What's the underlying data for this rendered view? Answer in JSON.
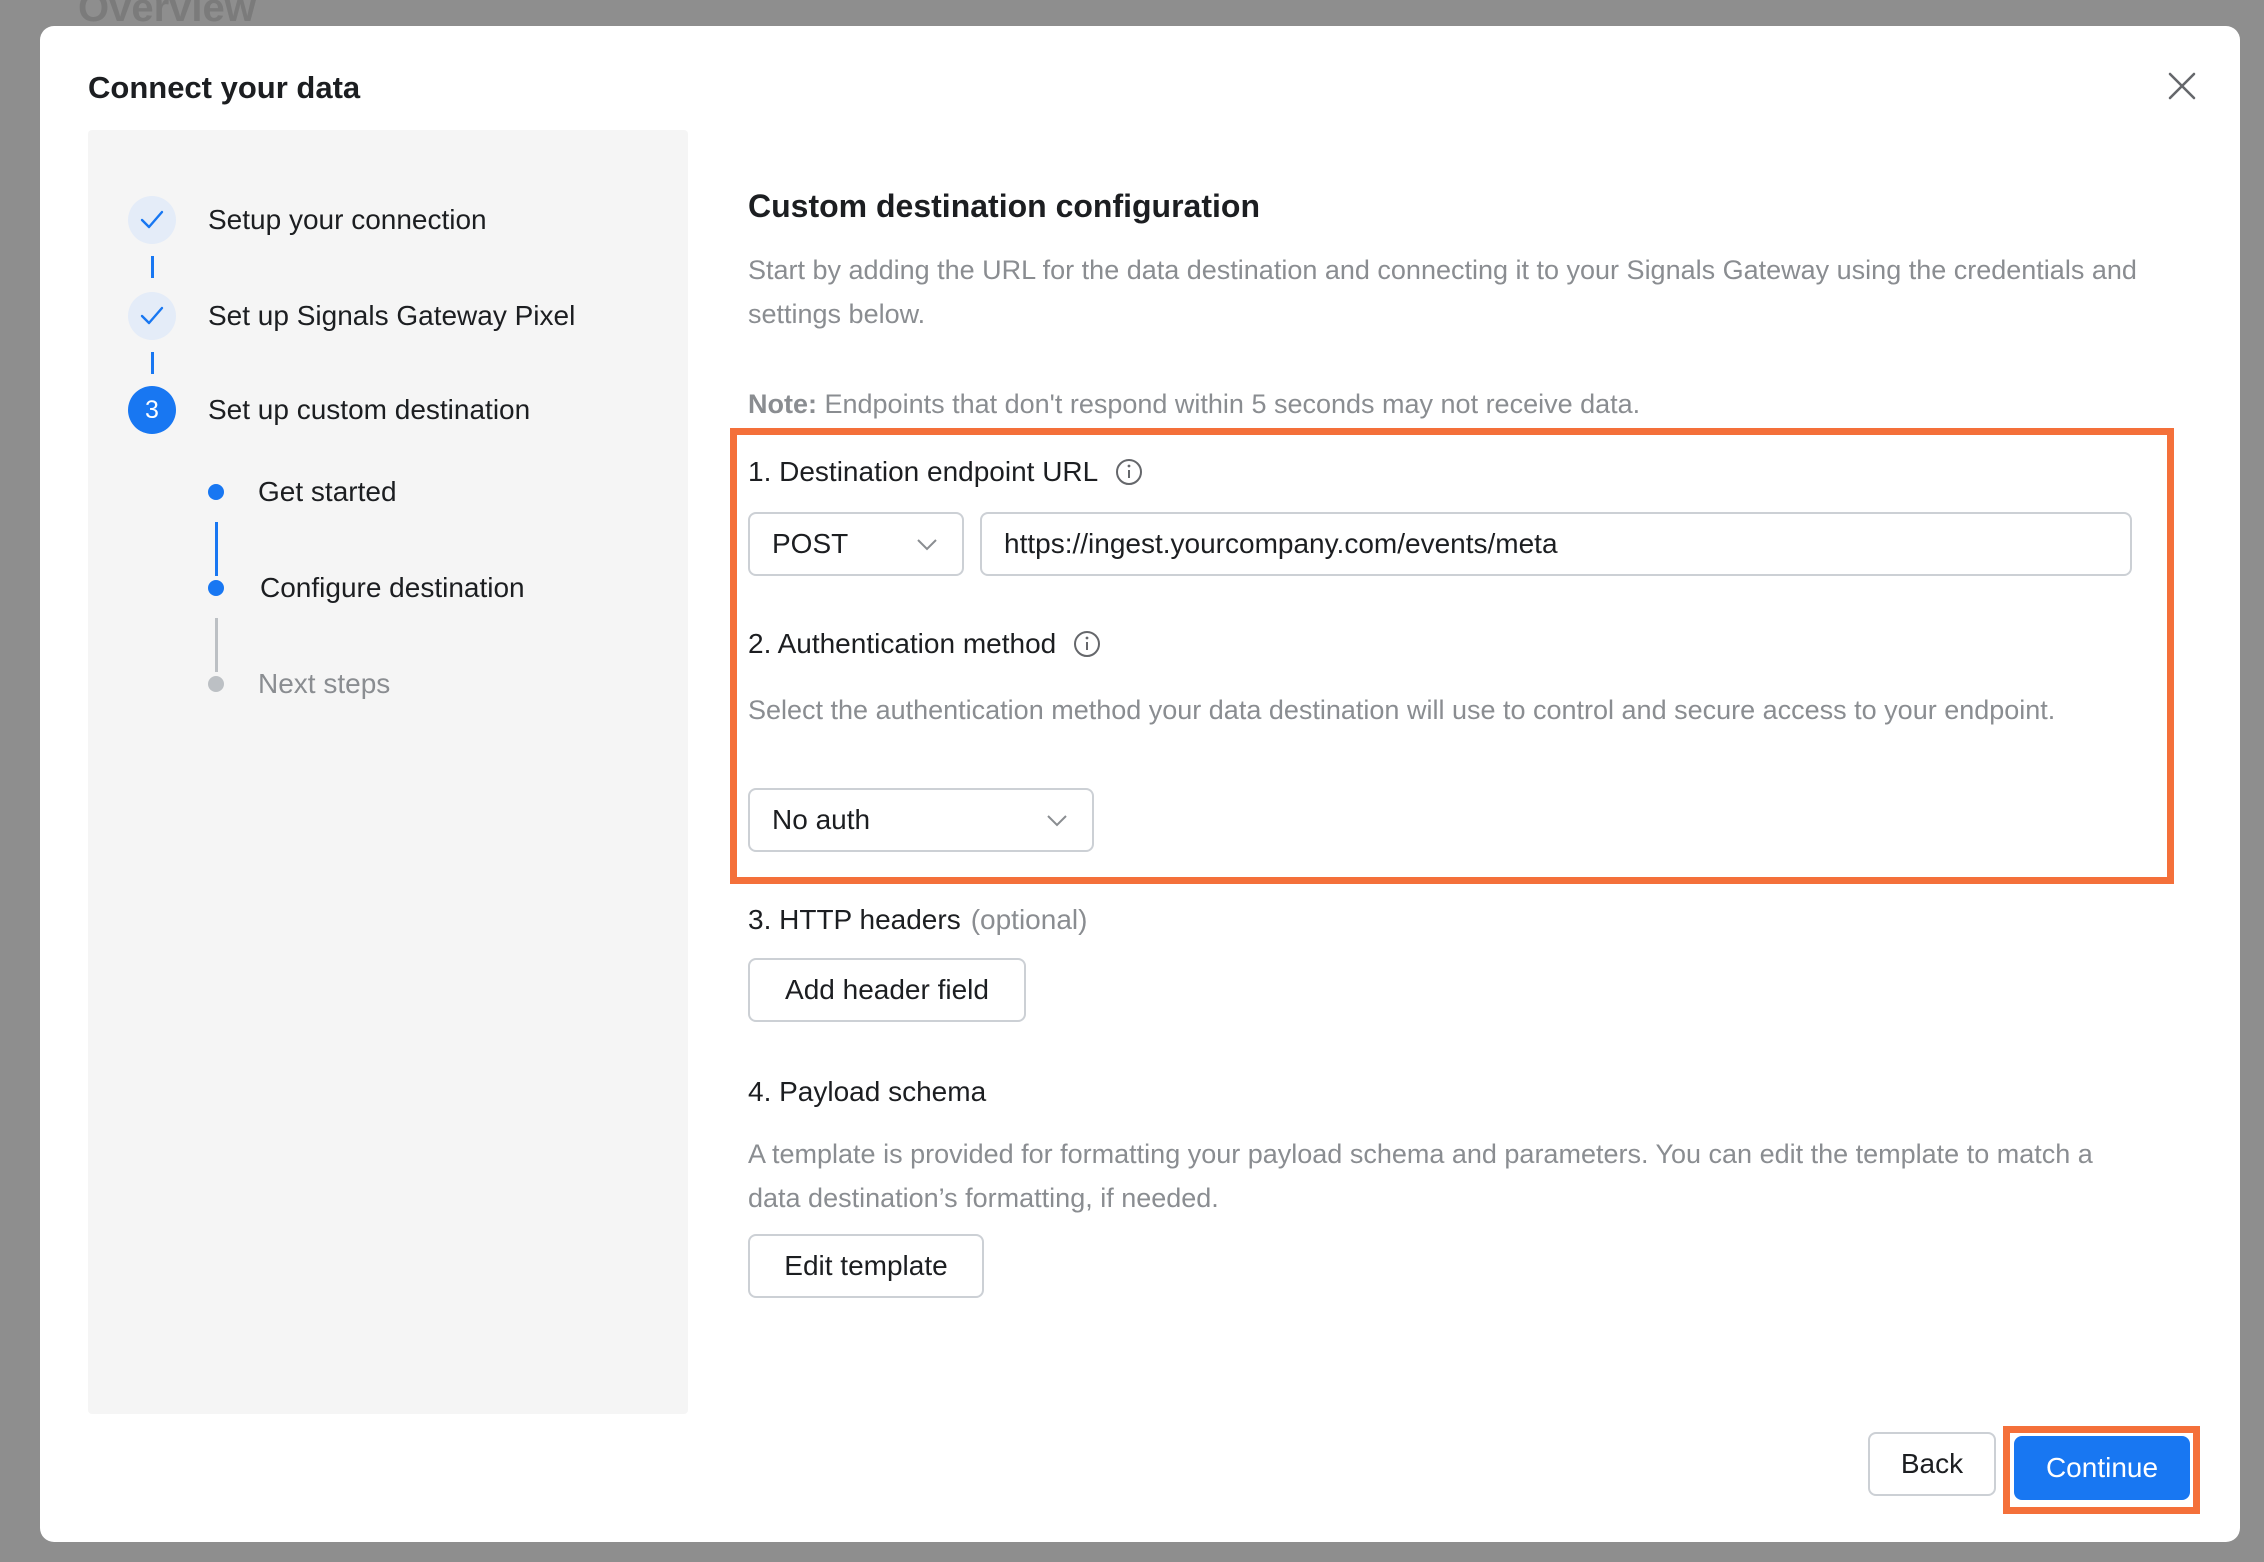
{
  "backdrop": {
    "title": "Overview"
  },
  "modal": {
    "title": "Connect your data",
    "close_icon": "close-icon"
  },
  "sidebar": {
    "steps": [
      {
        "label": "Setup your connection",
        "state": "done"
      },
      {
        "label": "Set up Signals Gateway Pixel",
        "state": "done"
      },
      {
        "label": "Set up custom destination",
        "state": "active",
        "number": "3"
      }
    ],
    "substeps": [
      {
        "label": "Get started",
        "state": "done"
      },
      {
        "label": "Configure destination",
        "state": "active"
      },
      {
        "label": "Next steps",
        "state": "pending"
      }
    ]
  },
  "main": {
    "title": "Custom destination configuration",
    "description": "Start by adding the URL for the data destination and connecting it to your Signals Gateway using the credentials and settings below.",
    "note_label": "Note:",
    "note_text": " Endpoints that don't respond within 5 seconds may not receive data.",
    "endpoint": {
      "label": "1. Destination endpoint URL",
      "method": "POST",
      "url": "https://ingest.yourcompany.com/events/meta"
    },
    "auth": {
      "label": "2. Authentication method",
      "description": "Select the authentication method your data destination will use to control and secure access to your endpoint.",
      "selected": "No auth"
    },
    "headers": {
      "label": "3. HTTP headers",
      "optional": "(optional)",
      "button": "Add header field"
    },
    "payload": {
      "label": "4. Payload schema",
      "description": "A template is provided for formatting your payload schema and parameters. You can edit the template to match a data destination’s formatting, if needed.",
      "button": "Edit template"
    }
  },
  "footer": {
    "back": "Back",
    "continue": "Continue"
  },
  "colors": {
    "accent": "#1877f2",
    "highlight": "#f4703a"
  }
}
